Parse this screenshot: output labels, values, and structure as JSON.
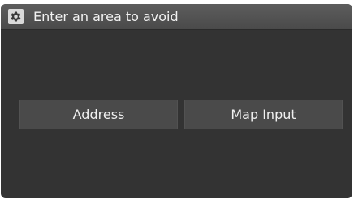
{
  "header": {
    "icon": "gear-icon",
    "title": "Enter an area to avoid"
  },
  "options": {
    "address_label": "Address",
    "map_input_label": "Map Input"
  },
  "colors": {
    "screen_background": "#333333",
    "title_bar": "#4f4f4f",
    "button_background": "#4a4a4a",
    "text": "#f0f0f0"
  }
}
